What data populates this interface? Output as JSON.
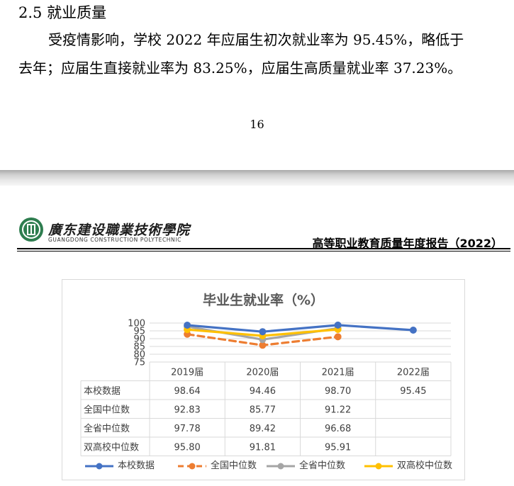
{
  "page1": {
    "section_heading": "2.5 就业质量",
    "paragraph_line1": "受疫情影响，学校 2022 年应届生初次就业率为 95.45%，略低于",
    "paragraph_line2": "去年；应届生直接就业率为  83.25%，应届生高质量就业率  37.23%。",
    "page_number": "16"
  },
  "page2": {
    "header": {
      "school_name_cn": "廣东建设職業技術學院",
      "school_name_en": "GUANGDONG CONSTRUCTION POLYTECHNIC",
      "report_title": "高等职业教育质量年度报告（2022）"
    }
  },
  "colors": {
    "school": "#4472C4",
    "national": "#ED7D31",
    "provincial": "#A5A5A5",
    "double_high": "#FFC000",
    "grid": "#d9d9d9",
    "text": "#404040"
  },
  "chart_data": {
    "type": "line",
    "title": "毕业生就业率（%）",
    "categories": [
      "2019届",
      "2020届",
      "2021届",
      "2022届"
    ],
    "y_ticks": [
      "100",
      "95",
      "90",
      "85",
      "80",
      "75"
    ],
    "ylim": [
      75,
      100
    ],
    "grid": true,
    "legend_position": "bottom",
    "series": [
      {
        "name": "本校数据",
        "values": [
          98.64,
          94.46,
          98.7,
          95.45
        ],
        "labels": [
          "98.64",
          "94.46",
          "98.70",
          "95.45"
        ],
        "style": "solid",
        "color_key": "school"
      },
      {
        "name": "全国中位数",
        "values": [
          92.83,
          85.77,
          91.22,
          null
        ],
        "labels": [
          "92.83",
          "85.77",
          "91.22",
          ""
        ],
        "style": "dashed",
        "color_key": "national"
      },
      {
        "name": "全省中位数",
        "values": [
          97.78,
          89.42,
          96.68,
          null
        ],
        "labels": [
          "97.78",
          "89.42",
          "96.68",
          ""
        ],
        "style": "solid",
        "color_key": "provincial"
      },
      {
        "name": "双高校中位数",
        "values": [
          95.8,
          91.81,
          95.91,
          null
        ],
        "labels": [
          "95.80",
          "91.81",
          "95.91",
          ""
        ],
        "style": "solid",
        "color_key": "double_high"
      }
    ]
  }
}
